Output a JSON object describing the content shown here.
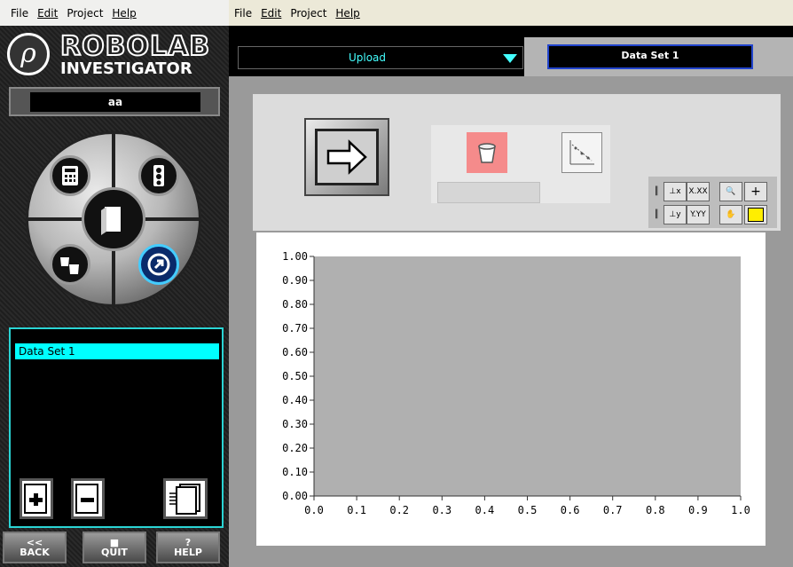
{
  "left_menu": [
    "File",
    "Edit",
    "Project",
    "Help"
  ],
  "right_menu": [
    "File",
    "Edit",
    "Project",
    "Help"
  ],
  "logo": {
    "line1": "ROBOLAB",
    "line2": "INVESTIGATOR",
    "symbol": "ρ"
  },
  "name_field": {
    "value": "aa"
  },
  "data_sets": {
    "items": [
      "Data Set 1"
    ]
  },
  "bottom_buttons": {
    "back": {
      "arrow": "<<",
      "label": "BACK"
    },
    "quit": {
      "mark": "■",
      "label": "QUIT"
    },
    "help": {
      "mark": "?",
      "label": "HELP"
    }
  },
  "upload_select": {
    "value": "Upload"
  },
  "tab": {
    "label": "Data Set 1"
  },
  "graph_tools": {
    "x_format": "X.XX",
    "y_format": "Y.YY"
  },
  "chart_data": {
    "type": "line",
    "title": "",
    "xlabel": "",
    "ylabel": "",
    "xlim": [
      0.0,
      1.0
    ],
    "ylim": [
      0.0,
      1.0
    ],
    "xticks": [
      "0.0",
      "0.1",
      "0.2",
      "0.3",
      "0.4",
      "0.5",
      "0.6",
      "0.7",
      "0.8",
      "0.9",
      "1.0"
    ],
    "yticks": [
      "1.00",
      "0.90",
      "0.80",
      "0.70",
      "0.60",
      "0.50",
      "0.40",
      "0.30",
      "0.20",
      "0.10",
      "0.00"
    ],
    "series": [],
    "plot_bg": "#b0b0b0",
    "grid": false
  },
  "colors": {
    "accent_cyan": "#00ffff",
    "tab_border": "#2244cc",
    "bucket": "#f58b8b"
  }
}
